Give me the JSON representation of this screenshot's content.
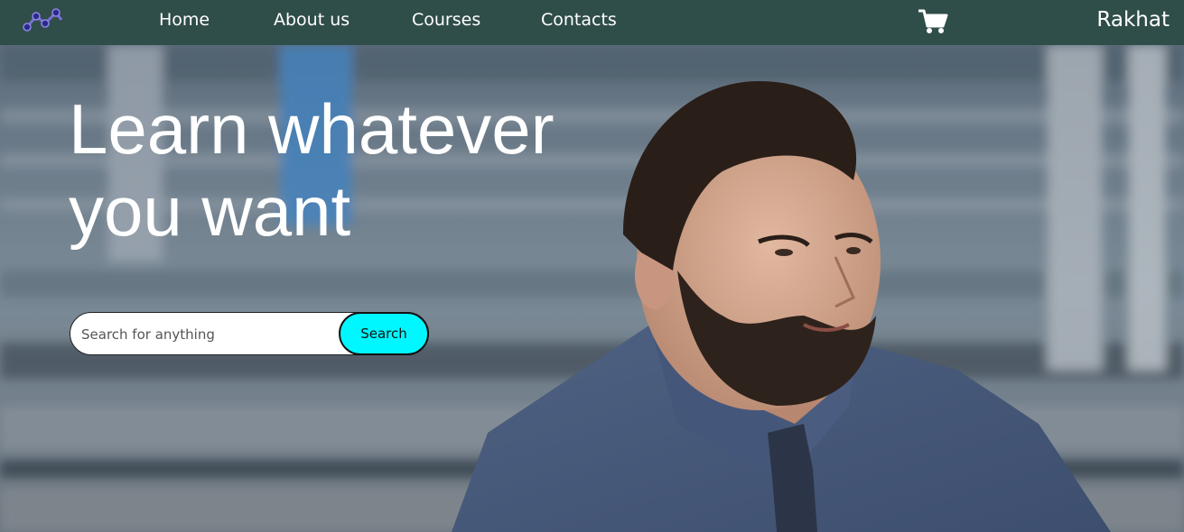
{
  "nav": {
    "logo_icon": "network-graph-icon",
    "links": [
      "Home",
      "About us",
      "Courses",
      "Contacts"
    ],
    "cart_icon": "shopping-cart-icon",
    "user": "Rakhat"
  },
  "hero": {
    "title_line1": "Learn whatever",
    "title_line2": "you want",
    "search": {
      "placeholder": "Search for anything",
      "value": "",
      "button_label": "Search",
      "button_color": "#00f7ff"
    }
  },
  "colors": {
    "navbar": "#2f4d49",
    "text": "#ffffff"
  }
}
